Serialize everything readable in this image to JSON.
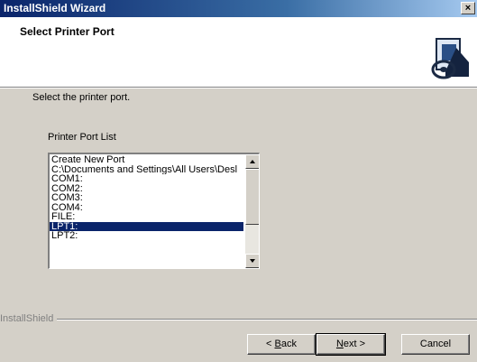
{
  "window": {
    "title": "InstallShield Wizard",
    "close_label": "×"
  },
  "header": {
    "title": "Select Printer Port",
    "icon": "printer-cd-icon"
  },
  "instruction": "Select the printer port.",
  "port_list": {
    "label": "Printer Port List",
    "items": [
      "Create New Port",
      "C:\\Documents and Settings\\All Users\\Desl",
      "COM1:",
      "COM2:",
      "COM3:",
      "COM4:",
      "FILE:",
      "LPT1:",
      "LPT2:"
    ],
    "selected": "LPT1:"
  },
  "footer": {
    "brand": "InstallShield",
    "back_prefix": "< ",
    "back_mnemonic": "B",
    "back_rest": "ack",
    "next_mnemonic": "N",
    "next_rest": "ext >",
    "cancel_label": "Cancel"
  },
  "colors": {
    "title_start": "#0a246a",
    "title_end": "#a6caf0",
    "selection": "#0a246a",
    "face": "#d4d0c8"
  }
}
